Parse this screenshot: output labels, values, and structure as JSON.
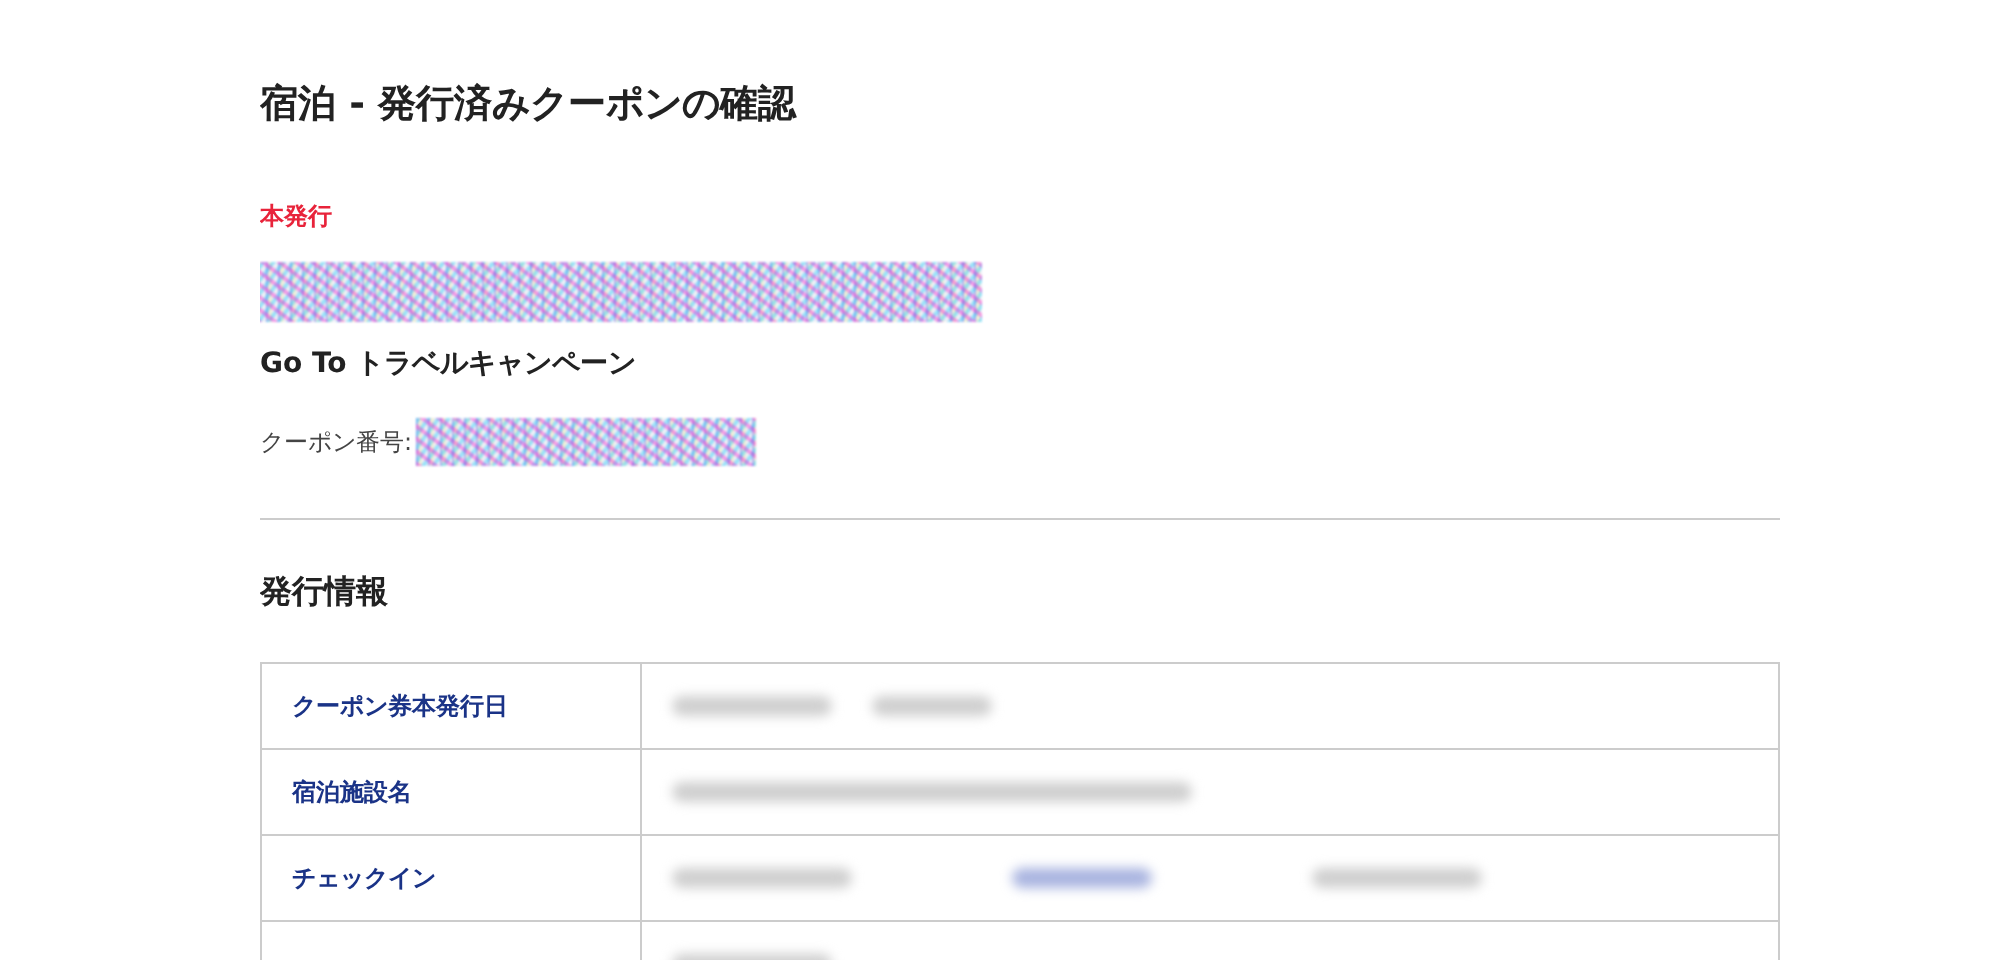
{
  "page_title": "宿泊 - 発行済みクーポンの確認",
  "status": "本発行",
  "redacted_heading": {
    "kind": "noise"
  },
  "campaign": "Go To トラベルキャンペーン",
  "coupon_number": {
    "label": "クーポン番号:",
    "value": {
      "kind": "noise"
    }
  },
  "section_title": "発行情報",
  "table": {
    "rows": [
      {
        "label": "クーポン券本発行日",
        "values": [
          {
            "kind": "blur"
          },
          {
            "kind": "blur"
          }
        ]
      },
      {
        "label": "宿泊施設名",
        "values": [
          {
            "kind": "blur"
          }
        ]
      },
      {
        "label": "チェックイン",
        "values": [
          {
            "kind": "blur"
          },
          {
            "kind": "blur_link"
          },
          {
            "kind": "blur"
          }
        ]
      },
      {
        "values": [
          {
            "kind": "blur"
          }
        ]
      }
    ]
  }
}
